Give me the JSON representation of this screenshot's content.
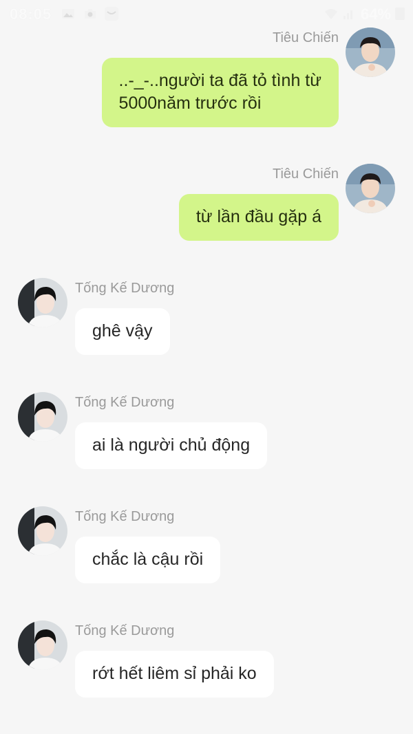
{
  "status_bar": {
    "time": "08:05",
    "battery": "64%"
  },
  "messages": [
    {
      "side": "right",
      "sender": "Tiêu Chiến",
      "lines": [
        "..-_-..người ta đã tỏ tình từ",
        "5000năm trước rồi"
      ]
    },
    {
      "side": "right",
      "sender": "Tiêu Chiến",
      "lines": [
        "từ lần đầu gặp á"
      ]
    },
    {
      "side": "left",
      "sender": "Tống Kế Dương",
      "lines": [
        "ghê vậy"
      ]
    },
    {
      "side": "left",
      "sender": "Tống Kế Dương",
      "lines": [
        "ai là người chủ động"
      ]
    },
    {
      "side": "left",
      "sender": "Tống Kế Dương",
      "lines": [
        "chắc là cậu rồi"
      ]
    },
    {
      "side": "left",
      "sender": "Tống Kế Dương",
      "lines": [
        "rớt hết liêm sỉ phải ko"
      ]
    }
  ],
  "colors": {
    "background": "#f6f6f6",
    "outgoing_bubble": "#d3f58a",
    "incoming_bubble": "#ffffff",
    "sender_name": "#9a9a9a"
  }
}
